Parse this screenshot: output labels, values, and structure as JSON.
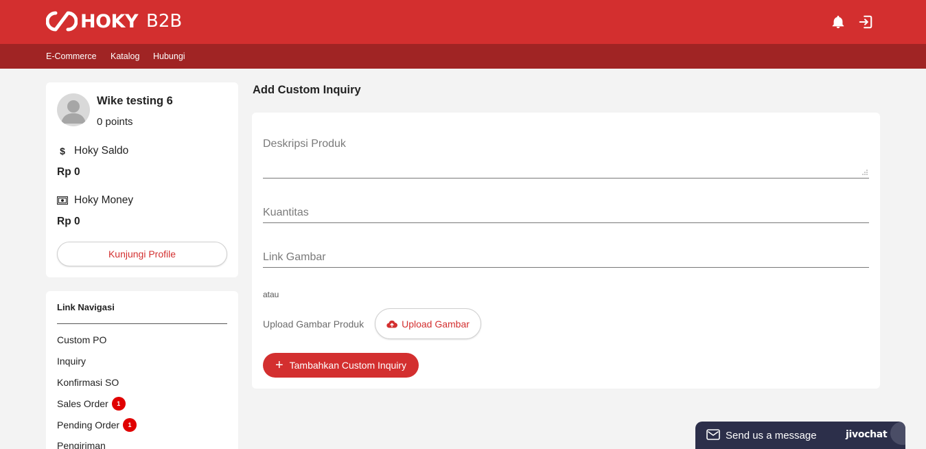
{
  "header": {
    "brand": "HOKY",
    "brand_sub": "B2B"
  },
  "subnav": {
    "items": [
      "E-Commerce",
      "Katalog",
      "Hubungi"
    ]
  },
  "profile": {
    "name": "Wike testing 6",
    "points": "0 points",
    "saldo_label": "Hoky Saldo",
    "saldo_icon": "$",
    "saldo_value": "Rp 0",
    "money_label": "Hoky Money",
    "money_value": "Rp 0",
    "visit_button": "Kunjungi Profile"
  },
  "nav": {
    "title": "Link Navigasi",
    "items": [
      {
        "label": "Custom PO",
        "badge": ""
      },
      {
        "label": "Inquiry",
        "badge": ""
      },
      {
        "label": "Konfirmasi SO",
        "badge": ""
      },
      {
        "label": "Sales Order",
        "badge": "1"
      },
      {
        "label": "Pending Order",
        "badge": "1"
      },
      {
        "label": "Pengiriman",
        "badge": ""
      }
    ]
  },
  "main": {
    "title": "Add Custom Inquiry",
    "form": {
      "deskripsi_label": "Deskripsi Produk",
      "kuantitas_label": "Kuantitas",
      "link_label": "Link Gambar",
      "atau": "atau",
      "upload_label": "Upload Gambar Produk",
      "upload_button": "Upload Gambar",
      "submit_button": "Tambahkan Custom Inquiry"
    }
  },
  "chat": {
    "message": "Send us a message",
    "brand": "jivochat"
  },
  "colors": {
    "primary": "#d32f2f",
    "subnav": "#a02424",
    "background": "#f3f3f3",
    "badge": "#e00000",
    "chat": "#2c2f4a"
  }
}
